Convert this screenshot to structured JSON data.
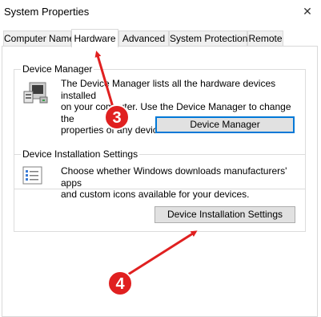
{
  "window": {
    "title": "System Properties",
    "close_symbol": "✕"
  },
  "tabs": [
    {
      "label": "Computer Name",
      "active": false
    },
    {
      "label": "Hardware",
      "active": true
    },
    {
      "label": "Advanced",
      "active": false
    },
    {
      "label": "System Protection",
      "active": false
    },
    {
      "label": "Remote",
      "active": false
    }
  ],
  "device_manager": {
    "group_label": "Device Manager",
    "description_lines": [
      "The Device Manager lists all the hardware devices installed",
      "on your computer. Use the Device Manager to change the",
      "properties of any device."
    ],
    "button_label": "Device Manager",
    "icon": "computer-device-icon"
  },
  "device_installation": {
    "group_label": "Device Installation Settings",
    "description_lines": [
      "Choose whether Windows downloads manufacturers' apps",
      "and custom icons available for your devices."
    ],
    "button_label": "Device Installation Settings",
    "icon": "checklist-settings-icon"
  },
  "annotations": [
    {
      "number": "3",
      "color": "#e02020"
    },
    {
      "number": "4",
      "color": "#e02020"
    }
  ]
}
